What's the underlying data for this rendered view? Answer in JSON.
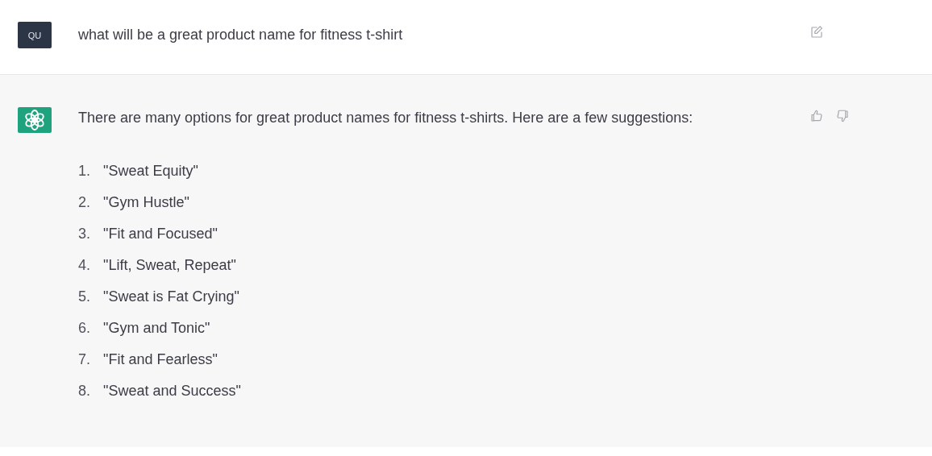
{
  "messages": [
    {
      "kind": "user",
      "avatar": "QU",
      "text": "what will be a great product name for fitness t-shirt"
    },
    {
      "kind": "assistant",
      "text": "There are many options for great product names for fitness t-shirts. Here are a few suggestions:",
      "list": [
        {
          "number": "1.",
          "text": "\"Sweat Equity\""
        },
        {
          "number": "2.",
          "text": "\"Gym Hustle\""
        },
        {
          "number": "3.",
          "text": "\"Fit and Focused\""
        },
        {
          "number": "4.",
          "text": "\"Lift, Sweat, Repeat\""
        },
        {
          "number": "5.",
          "text": "\"Sweat is Fat Crying\""
        },
        {
          "number": "6.",
          "text": "\"Gym and Tonic\""
        },
        {
          "number": "7.",
          "text": "\"Fit and Fearless\""
        },
        {
          "number": "8.",
          "text": "\"Sweat and Success\""
        }
      ]
    }
  ]
}
